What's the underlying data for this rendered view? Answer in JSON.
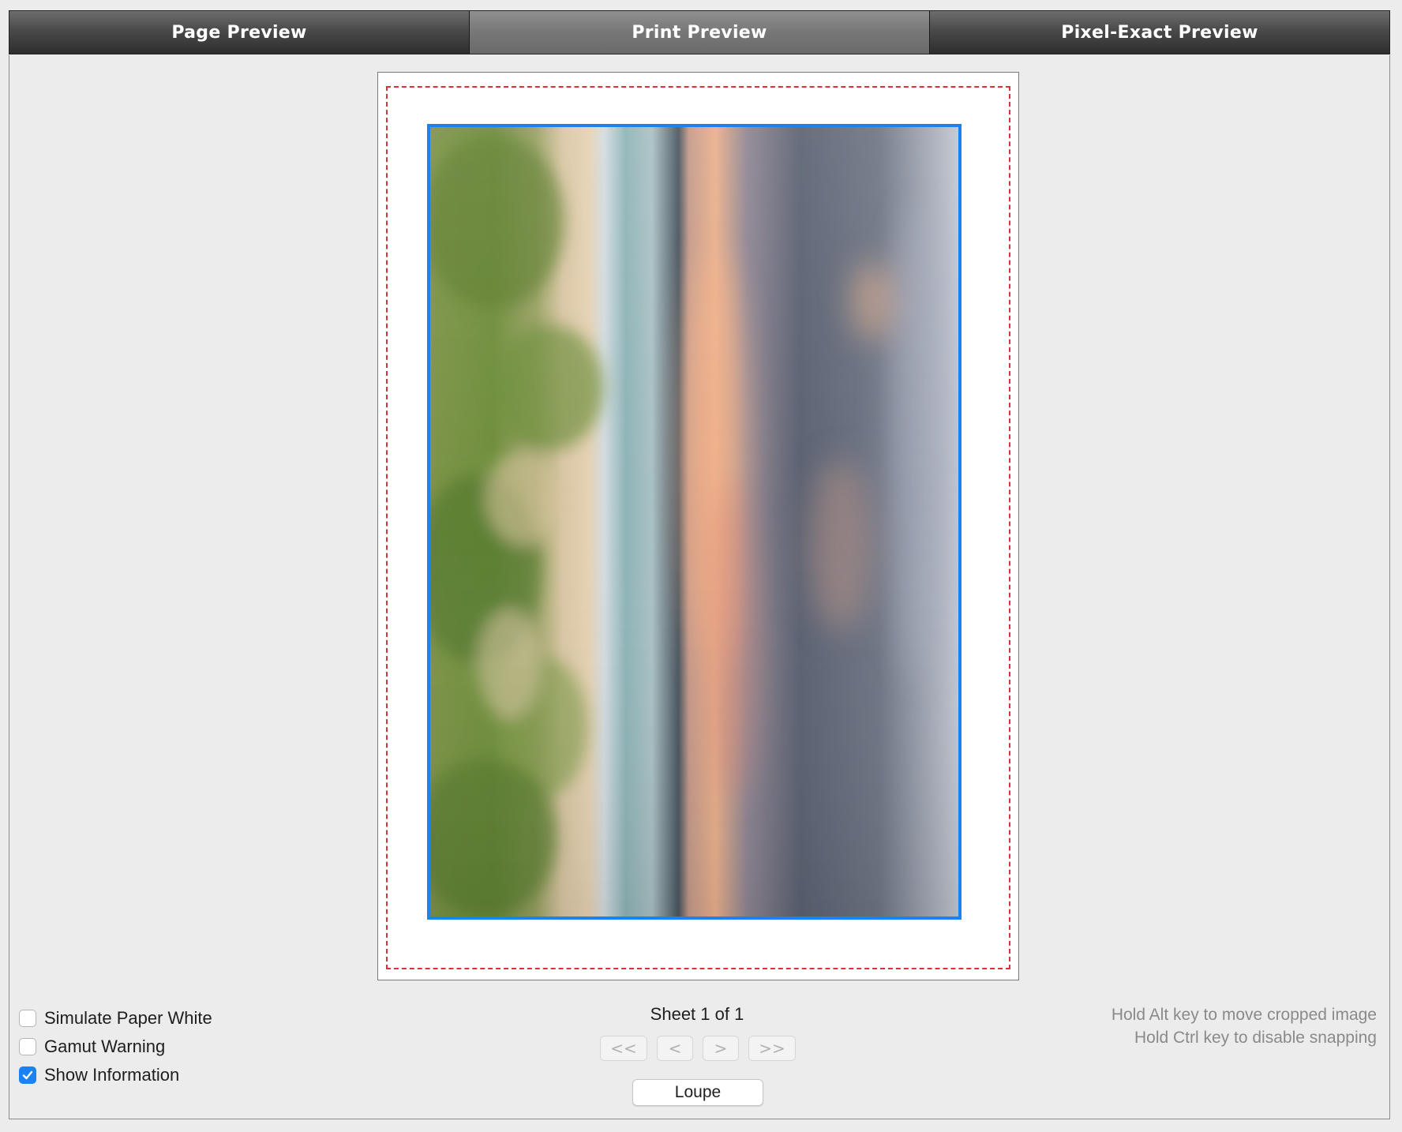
{
  "tabs": [
    {
      "label": "Page Preview",
      "active": false
    },
    {
      "label": "Print Preview",
      "active": true
    },
    {
      "label": "Pixel-Exact Preview",
      "active": false
    }
  ],
  "options": {
    "simulate_paper_white": {
      "label": "Simulate Paper White",
      "checked": false
    },
    "gamut_warning": {
      "label": "Gamut Warning",
      "checked": false
    },
    "show_information": {
      "label": "Show Information",
      "checked": true
    }
  },
  "sheet": {
    "label": "Sheet 1 of 1"
  },
  "nav": {
    "first": "<<",
    "prev": "<",
    "next": ">",
    "last": ">>"
  },
  "loupe": {
    "label": "Loupe"
  },
  "hints": {
    "alt": "Hold Alt key to move cropped image",
    "ctrl": "Hold Ctrl key to disable snapping"
  },
  "colors": {
    "selection": "#1a82f2",
    "margin_guide": "#d8333a"
  },
  "icons": {
    "checkmark": "checkmark-icon"
  }
}
